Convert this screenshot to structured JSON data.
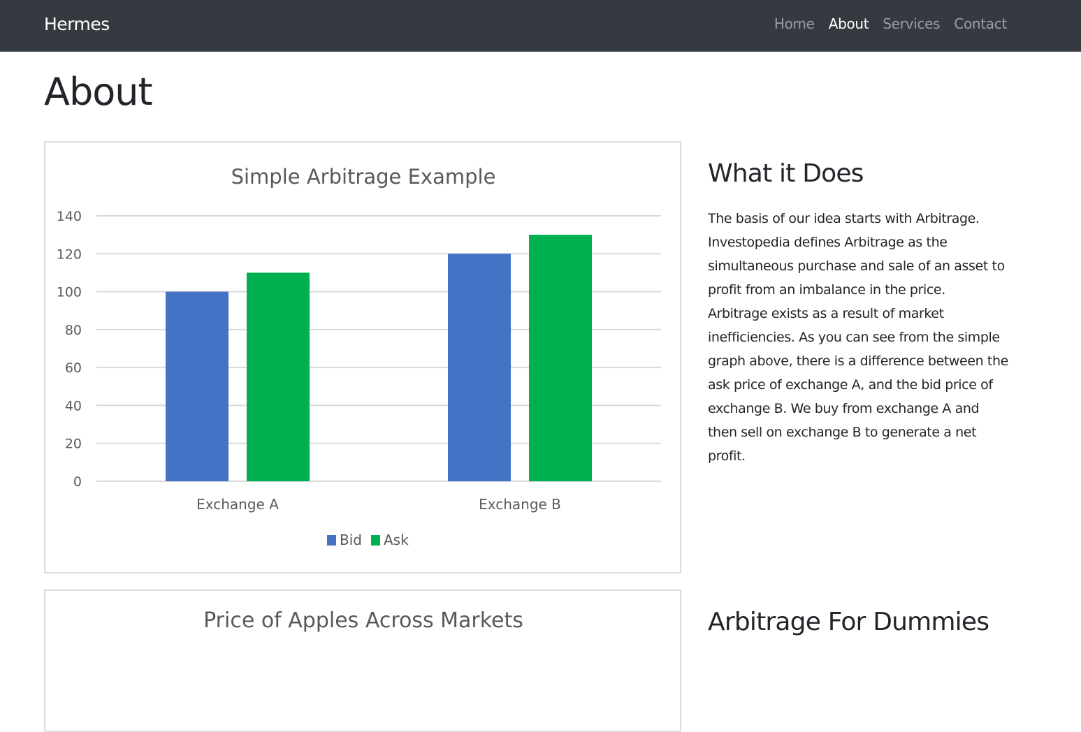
{
  "nav": {
    "brand": "Hermes",
    "links": [
      "Home",
      "About",
      "Services",
      "Contact"
    ],
    "active": "About"
  },
  "page": {
    "title": "About"
  },
  "section1": {
    "heading": "What it Does",
    "text": "The basis of our idea starts with Arbitrage. Investopedia defines Arbitrage as the simultaneous purchase and sale of an asset to profit from an imbalance in the price. Arbitrage exists as a result of market inefficiencies. As you can see from the simple graph above, there is a difference between the ask price of exchange A, and the bid price of exchange B. We buy from exchange A and then sell on exchange B to generate a net profit."
  },
  "section2": {
    "heading": "Arbitrage For Dummies",
    "chart_title": "Price of Apples Across Markets"
  },
  "colors": {
    "navbar": "#343a40",
    "bid": "#4472c4",
    "ask": "#00b050",
    "grid": "#d9d9d9",
    "axis_text": "#595959"
  },
  "chart_data": {
    "type": "bar",
    "title": "Simple Arbitrage Example",
    "categories": [
      "Exchange A",
      "Exchange B"
    ],
    "series": [
      {
        "name": "Bid",
        "values": [
          100,
          120
        ]
      },
      {
        "name": "Ask",
        "values": [
          110,
          130
        ]
      }
    ],
    "ylim": [
      0,
      140
    ],
    "yticks": [
      0,
      20,
      40,
      60,
      80,
      100,
      120,
      140
    ],
    "grid": true,
    "legend": "bottom",
    "xlabel": "",
    "ylabel": ""
  }
}
